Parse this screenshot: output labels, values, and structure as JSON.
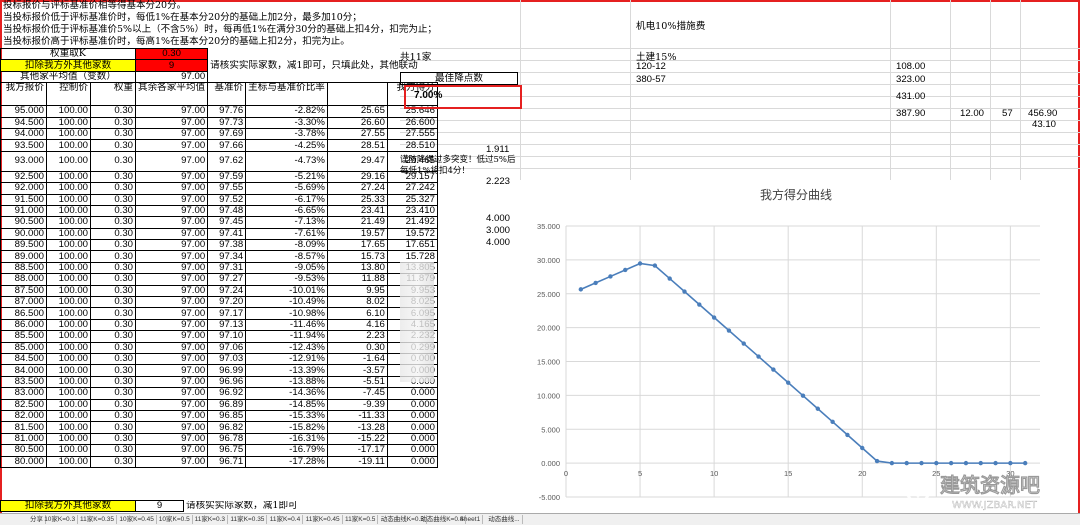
{
  "notes": [
    "投标报价与评标基准价相等得基本分20分。",
    "当投标报价低于评标基准价时，每低1%在基本分20分的基础上加2分，最多加10分；",
    "当投标报价低于评标基准价5%以上（不含5%）时，每再低1%在满分30分的基础上扣4分，扣完为止；",
    "当投标报价高于评标基准价时，每高1%在基本分20分的基础上扣2分，扣完为止。"
  ],
  "weight": {
    "label": "权重取K",
    "value": "0.30"
  },
  "exclude": {
    "label": "扣除我方外其他家数",
    "value": "9",
    "note": "请核实实际家数，减1即可，只填此处，其他联动",
    "note_short": "请核实实际家数，减1即可"
  },
  "avg_others": {
    "label": "其他家平均值（变数）",
    "value": "97.00"
  },
  "total_bidders": "共11家",
  "best": {
    "label": "最佳降点数",
    "value": "7.00%"
  },
  "side_notes": {
    "n1": "1.911",
    "warn": "谨防降得过多突变！低过5%后每低1%将扣4分！",
    "n2": "2.223",
    "n3": "4.000",
    "n4": "3.000",
    "n5": "4.000"
  },
  "headers": [
    "我方报价",
    "控制价",
    "权重",
    "其余各家平均值",
    "基准价",
    "主标与基准价比率",
    "",
    "我方得分"
  ],
  "rows": [
    [
      "95.000",
      "100.00",
      "0.30",
      "97.00",
      "97.76",
      "-2.82%",
      "25.65",
      "25.646"
    ],
    [
      "94.500",
      "100.00",
      "0.30",
      "97.00",
      "97.73",
      "-3.30%",
      "26.60",
      "26.600"
    ],
    [
      "94.000",
      "100.00",
      "0.30",
      "97.00",
      "97.69",
      "-3.78%",
      "27.55",
      "27.555"
    ],
    [
      "93.500",
      "100.00",
      "0.30",
      "97.00",
      "97.66",
      "-4.25%",
      "28.51",
      "28.510"
    ],
    [
      "93.000",
      "100.00",
      "0.30",
      "97.00",
      "97.62",
      "-4.73%",
      "29.47",
      "29.465"
    ],
    [
      "92.500",
      "100.00",
      "0.30",
      "97.00",
      "97.59",
      "-5.21%",
      "29.16",
      "29.157"
    ],
    [
      "92.000",
      "100.00",
      "0.30",
      "97.00",
      "97.55",
      "-5.69%",
      "27.24",
      "27.242"
    ],
    [
      "91.500",
      "100.00",
      "0.30",
      "97.00",
      "97.52",
      "-6.17%",
      "25.33",
      "25.327"
    ],
    [
      "91.000",
      "100.00",
      "0.30",
      "97.00",
      "97.48",
      "-6.65%",
      "23.41",
      "23.410"
    ],
    [
      "90.500",
      "100.00",
      "0.30",
      "97.00",
      "97.45",
      "-7.13%",
      "21.49",
      "21.492"
    ],
    [
      "90.000",
      "100.00",
      "0.30",
      "97.00",
      "97.41",
      "-7.61%",
      "19.57",
      "19.572"
    ],
    [
      "89.500",
      "100.00",
      "0.30",
      "97.00",
      "97.38",
      "-8.09%",
      "17.65",
      "17.651"
    ],
    [
      "89.000",
      "100.00",
      "0.30",
      "97.00",
      "97.34",
      "-8.57%",
      "15.73",
      "15.728"
    ],
    [
      "88.500",
      "100.00",
      "0.30",
      "97.00",
      "97.31",
      "-9.05%",
      "13.80",
      "13.805"
    ],
    [
      "88.000",
      "100.00",
      "0.30",
      "97.00",
      "97.27",
      "-9.53%",
      "11.88",
      "11.879"
    ],
    [
      "87.500",
      "100.00",
      "0.30",
      "97.00",
      "97.24",
      "-10.01%",
      "9.95",
      "9.953"
    ],
    [
      "87.000",
      "100.00",
      "0.30",
      "97.00",
      "97.20",
      "-10.49%",
      "8.02",
      "8.025"
    ],
    [
      "86.500",
      "100.00",
      "0.30",
      "97.00",
      "97.17",
      "-10.98%",
      "6.10",
      "6.095"
    ],
    [
      "86.000",
      "100.00",
      "0.30",
      "97.00",
      "97.13",
      "-11.46%",
      "4.16",
      "4.165"
    ],
    [
      "85.500",
      "100.00",
      "0.30",
      "97.00",
      "97.10",
      "-11.94%",
      "2.23",
      "2.232"
    ],
    [
      "85.000",
      "100.00",
      "0.30",
      "97.00",
      "97.06",
      "-12.43%",
      "0.30",
      "0.299"
    ],
    [
      "84.500",
      "100.00",
      "0.30",
      "97.00",
      "97.03",
      "-12.91%",
      "-1.64",
      "0.000"
    ],
    [
      "84.000",
      "100.00",
      "0.30",
      "97.00",
      "96.99",
      "-13.39%",
      "-3.57",
      "0.000"
    ],
    [
      "83.500",
      "100.00",
      "0.30",
      "97.00",
      "96.96",
      "-13.88%",
      "-5.51",
      "0.000"
    ],
    [
      "83.000",
      "100.00",
      "0.30",
      "97.00",
      "96.92",
      "-14.36%",
      "-7.45",
      "0.000"
    ],
    [
      "82.500",
      "100.00",
      "0.30",
      "97.00",
      "96.89",
      "-14.85%",
      "-9.39",
      "0.000"
    ],
    [
      "82.000",
      "100.00",
      "0.30",
      "97.00",
      "96.85",
      "-15.33%",
      "-11.33",
      "0.000"
    ],
    [
      "81.500",
      "100.00",
      "0.30",
      "97.00",
      "96.82",
      "-15.82%",
      "-13.28",
      "0.000"
    ],
    [
      "81.000",
      "100.00",
      "0.30",
      "97.00",
      "96.78",
      "-16.31%",
      "-15.22",
      "0.000"
    ],
    [
      "80.500",
      "100.00",
      "0.30",
      "97.00",
      "96.75",
      "-16.79%",
      "-17.17",
      "0.000"
    ],
    [
      "80.000",
      "100.00",
      "0.30",
      "97.00",
      "96.71",
      "-17.28%",
      "-19.11",
      "0.000"
    ]
  ],
  "right_panel": {
    "title": "机电10%措施费",
    "sub": "土建15%",
    "r1_label": "120-12",
    "r1_val": "108.00",
    "r2_label": "380-57",
    "r2_val": "323.00",
    "r3_val": "431.00",
    "r4": [
      "387.90",
      "12.00",
      "57",
      "456.90"
    ],
    "r5": "43.10"
  },
  "chart_data": {
    "type": "line",
    "title": "我方得分曲线",
    "x": [
      1,
      2,
      3,
      4,
      5,
      6,
      7,
      8,
      9,
      10,
      11,
      12,
      13,
      14,
      15,
      16,
      17,
      18,
      19,
      20,
      21,
      22,
      23,
      24,
      25,
      26,
      27,
      28,
      29,
      30,
      31
    ],
    "values": [
      25.646,
      26.6,
      27.555,
      28.51,
      29.465,
      29.157,
      27.242,
      25.327,
      23.41,
      21.492,
      19.572,
      17.651,
      15.728,
      13.805,
      11.879,
      9.953,
      8.025,
      6.095,
      4.165,
      2.232,
      0.299,
      0,
      0,
      0,
      0,
      0,
      0,
      0,
      0,
      0,
      0
    ],
    "xlim": [
      0,
      32
    ],
    "ylim": [
      -5,
      35
    ],
    "yticks": [
      "-5.000",
      "0.000",
      "5.000",
      "10.000",
      "15.000",
      "20.000",
      "25.000",
      "30.000",
      "35.000"
    ],
    "xticks": [
      "0",
      "5",
      "10",
      "15",
      "20",
      "25",
      "30"
    ],
    "grid": true,
    "color": "#4a7ebb"
  },
  "tabs": [
    "分享",
    "10家K=0.3",
    "11家K=0.35",
    "10家K=0.45",
    "10家K=0.5",
    "11家K=0.3",
    "11家K=0.35",
    "11家K=0.4",
    "11家K=0.45",
    "11家K=0.5",
    "动态曲线K=0.3",
    "动态曲线K=0.4",
    "Sheet1",
    "动态曲线..."
  ],
  "watermark": {
    "text": "建筑资源吧",
    "url": "WWW.JZBAR.NET"
  }
}
